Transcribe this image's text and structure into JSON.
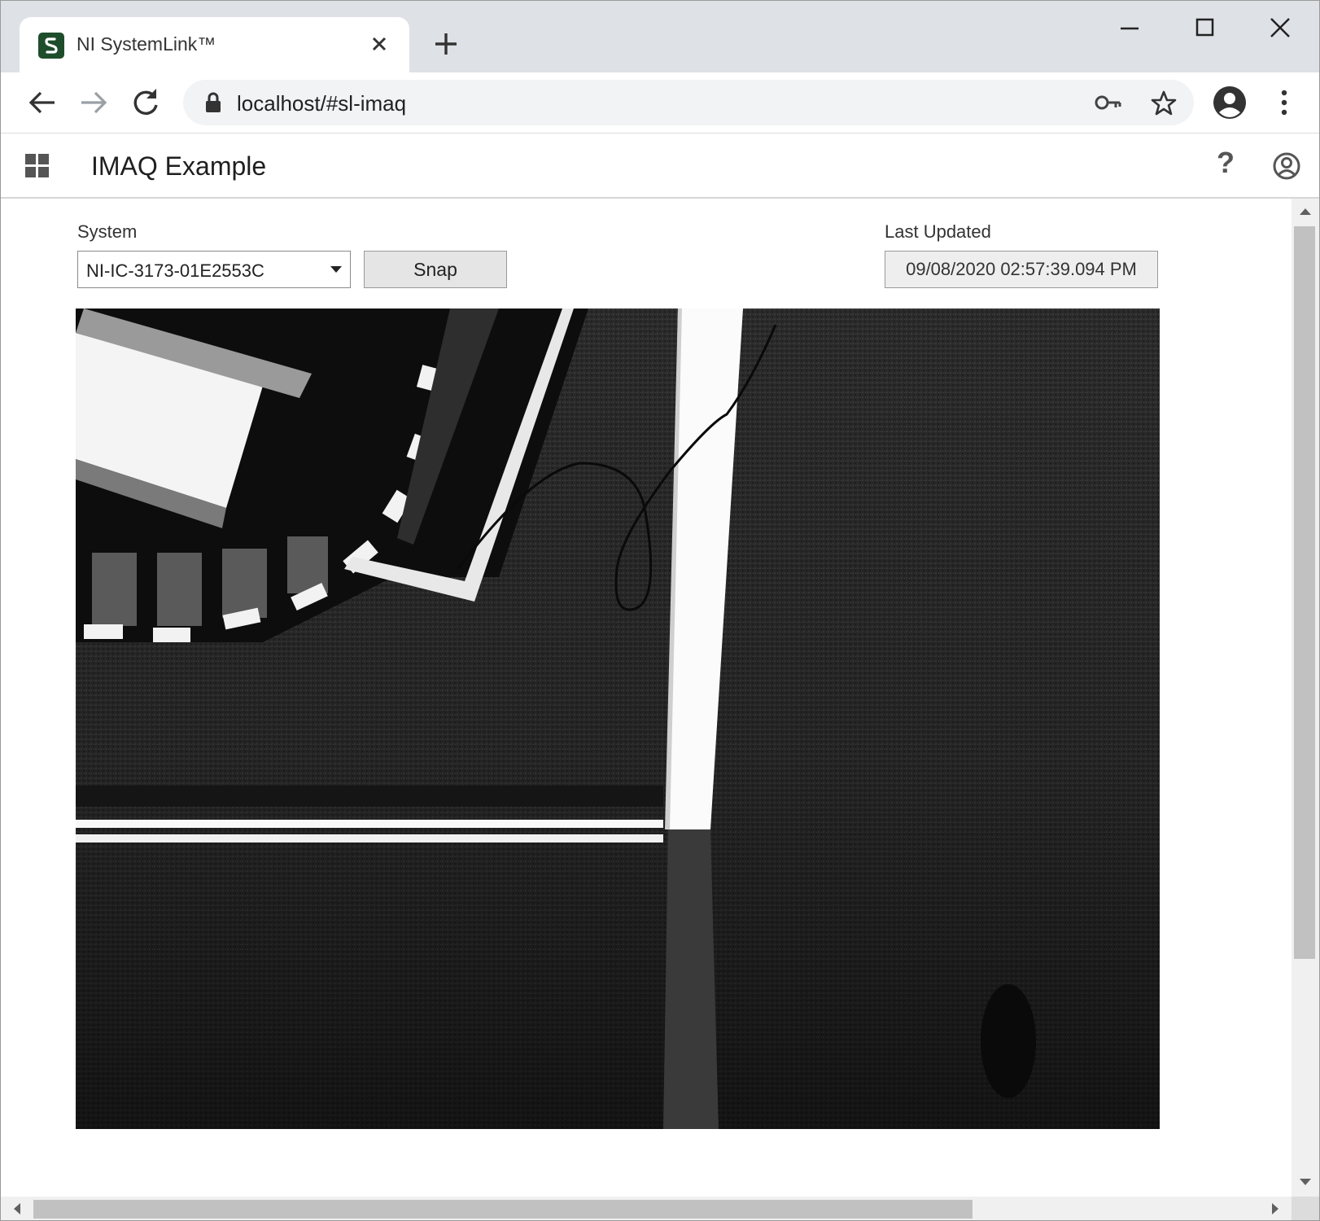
{
  "browser": {
    "tab_title": "NI SystemLink™",
    "url": "localhost/#sl-imaq"
  },
  "app": {
    "title": "IMAQ Example"
  },
  "form": {
    "system_label": "System",
    "system_value": "NI-IC-3173-01E2553C",
    "snap_label": "Snap",
    "last_updated_label": "Last Updated",
    "last_updated_value": "09/08/2020 02:57:39.094 PM"
  },
  "icons": {
    "favicon": "systemlink-logo-icon",
    "tab_close": "close-icon",
    "new_tab": "plus-icon",
    "back": "arrow-left-icon",
    "forward": "arrow-right-icon",
    "reload": "reload-icon",
    "lock": "lock-icon",
    "key": "key-icon",
    "star": "star-icon",
    "profile": "profile-icon",
    "menu": "kebab-menu-icon",
    "apps": "apps-grid-icon",
    "help": "help-icon",
    "user": "user-icon"
  },
  "colors": {
    "brand": "#1e4d2b",
    "tabstrip": "#dee1e6",
    "omnibox": "#f1f3f4"
  }
}
